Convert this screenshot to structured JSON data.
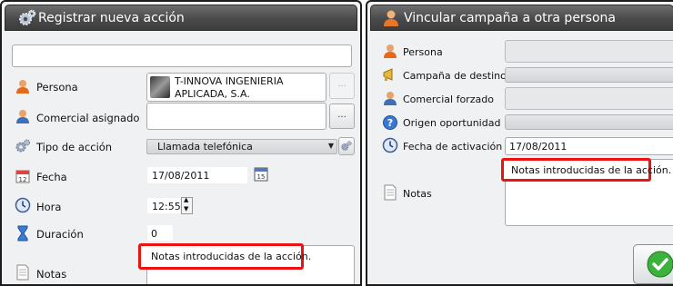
{
  "left_window": {
    "title": "Registrar nueva acción",
    "persona_label": "Persona",
    "persona_value_line1": "T-INNOVA INGENIERIA",
    "persona_value_line2": "APLICADA, S.A.",
    "persona_button": "...",
    "comercial_label": "Comercial asignado",
    "comercial_button": "...",
    "tipo_label": "Tipo de acción",
    "tipo_value": "Llamada telefónica",
    "fecha_label": "Fecha",
    "fecha_value": "17/08/2011",
    "calendar_day": "15",
    "hora_label": "Hora",
    "hora_value": "12:55",
    "duracion_label": "Duración",
    "duracion_value": "0",
    "notas_label": "Notas",
    "notas_value": "Notas introducidas de la acción."
  },
  "right_window": {
    "title": "Vincular campaña a otra persona",
    "persona_label": "Persona",
    "campana_label": "Campaña de destino",
    "comercial_label": "Comercial forzado",
    "origen_label": "Origen oportunidad",
    "fecha_label": "Fecha de activación",
    "fecha_value": "17/08/2011",
    "notas_label": "Notas",
    "notas_value": "Notas introducidas de la acción."
  },
  "colors": {
    "highlight": "#ee1111",
    "titlebar": "#4a4a4a",
    "background": "#eff1f3"
  }
}
